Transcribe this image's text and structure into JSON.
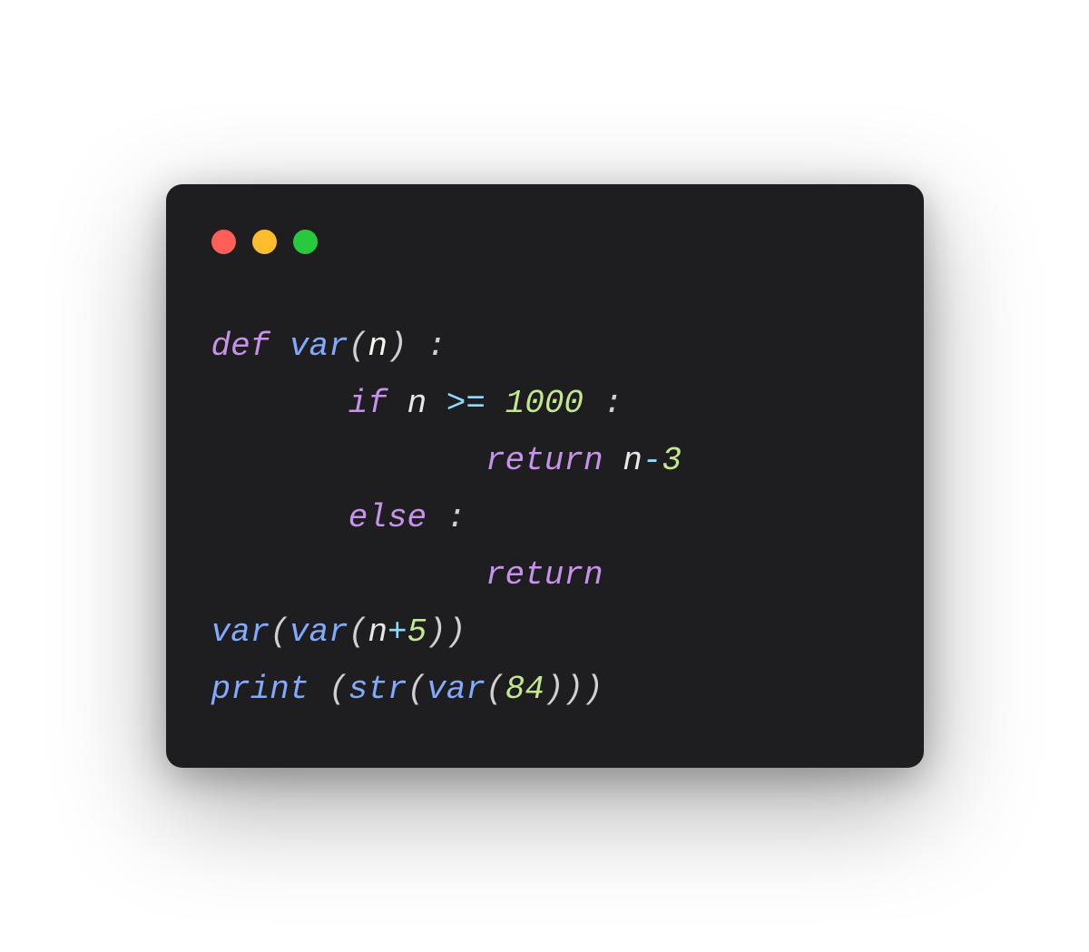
{
  "window": {
    "traffic_lights": {
      "red": "#ff5f56",
      "yellow": "#ffbd2e",
      "green": "#27c93f"
    }
  },
  "code": {
    "line1": {
      "kw_def": "def",
      "sp1": " ",
      "fn_name": "var",
      "open_paren": "(",
      "param": "n",
      "close_paren": ")",
      "sp2": " ",
      "colon": ":"
    },
    "line2": {
      "indent": "       ",
      "kw_if": "if",
      "sp1": " ",
      "var_n": "n",
      "sp2": " ",
      "op_gte": ">=",
      "sp3": " ",
      "num_1000": "1000",
      "sp4": " ",
      "colon": ":"
    },
    "line3": {
      "indent": "              ",
      "kw_return": "return",
      "sp1": " ",
      "var_n": "n",
      "op_minus": "-",
      "num_3": "3"
    },
    "line4": {
      "indent": "       ",
      "kw_else": "else",
      "sp1": " ",
      "colon": ":"
    },
    "line5": {
      "indent": "              ",
      "kw_return": "return",
      "sp1": " "
    },
    "line6": {
      "fn_var1": "var",
      "open1": "(",
      "fn_var2": "var",
      "open2": "(",
      "var_n": "n",
      "op_plus": "+",
      "num_5": "5",
      "close2": ")",
      "close1": ")"
    },
    "line7": {
      "fn_print": "print",
      "sp1": " ",
      "open1": "(",
      "fn_str": "str",
      "open2": "(",
      "fn_var": "var",
      "open3": "(",
      "num_84": "84",
      "close3": ")",
      "close2": ")",
      "close1": ")"
    }
  }
}
